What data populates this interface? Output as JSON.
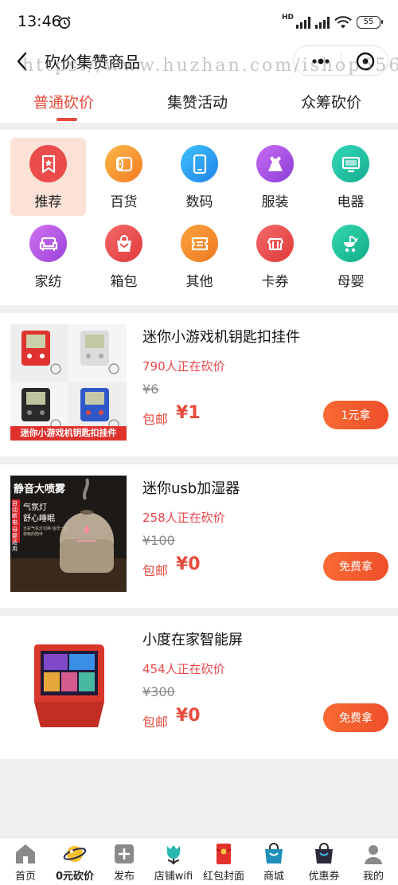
{
  "status": {
    "time": "13:46",
    "network": "HD",
    "battery": "55"
  },
  "nav": {
    "title": "砍价集赞商品",
    "watermark": "https://www.huzhan.com/ishop5564"
  },
  "tabs": [
    {
      "label": "普通砍价"
    },
    {
      "label": "集赞活动"
    },
    {
      "label": "众筹砍价"
    }
  ],
  "categories": [
    {
      "label": "推荐",
      "icon": "bookmark-star-icon",
      "color": "#ea4b4b"
    },
    {
      "label": "百货",
      "icon": "tissue-roll-icon",
      "color": "#f79a2d"
    },
    {
      "label": "数码",
      "icon": "tablet-icon",
      "color": "#2e9ff2"
    },
    {
      "label": "服装",
      "icon": "dress-icon",
      "color": "#a653e0"
    },
    {
      "label": "电器",
      "icon": "monitor-icon",
      "color": "#22c4a4"
    },
    {
      "label": "家纺",
      "icon": "sofa-icon",
      "color": "#b15ae3"
    },
    {
      "label": "箱包",
      "icon": "handbag-icon",
      "color": "#ee4b4b"
    },
    {
      "label": "其他",
      "icon": "ticket-icon",
      "color": "#f78a2d"
    },
    {
      "label": "卡券",
      "icon": "card-voucher-icon",
      "color": "#ee4b4b"
    },
    {
      "label": "母婴",
      "icon": "stroller-icon",
      "color": "#23c59c"
    }
  ],
  "products": [
    {
      "name": "迷你小游戏机钥匙扣挂件",
      "count": "790人正在砍价",
      "orig": "¥6",
      "ship": "包邮",
      "price": "¥1",
      "button": "1元拿",
      "thumb_text": "迷你小游戏机钥匙扣挂件"
    },
    {
      "name": "迷你usb加湿器",
      "count": "258人正在砍价",
      "orig": "¥100",
      "ship": "包邮",
      "price": "¥0",
      "button": "免费拿",
      "thumb_text": {
        "headline": "静音大喷雾",
        "line1": "气氛灯",
        "line2": "舒心睡眠",
        "badge1": "自动断电",
        "badge2": "母婴适用",
        "fine": "五彩气氛灯切换 给您一份夜晚的陪伴"
      }
    },
    {
      "name": "小度在家智能屏",
      "count": "454人正在砍价",
      "orig": "¥300",
      "ship": "包邮",
      "price": "¥0",
      "button": "免费拿"
    }
  ],
  "tabbar": [
    {
      "label": "首页",
      "icon": "home-icon"
    },
    {
      "label": "0元砍价",
      "icon": "planet-icon"
    },
    {
      "label": "发布",
      "icon": "plus-square-icon"
    },
    {
      "label": "店铺wifi",
      "icon": "tulip-icon"
    },
    {
      "label": "红包封面",
      "icon": "red-envelope-icon"
    },
    {
      "label": "商城",
      "icon": "store-bag-icon"
    },
    {
      "label": "优惠券",
      "icon": "coupon-bag-icon"
    },
    {
      "label": "我的",
      "icon": "user-icon"
    }
  ],
  "colors": {
    "accent": "#e84b3c",
    "button": "#f4602f",
    "active_bg": "#fbe1d6"
  }
}
